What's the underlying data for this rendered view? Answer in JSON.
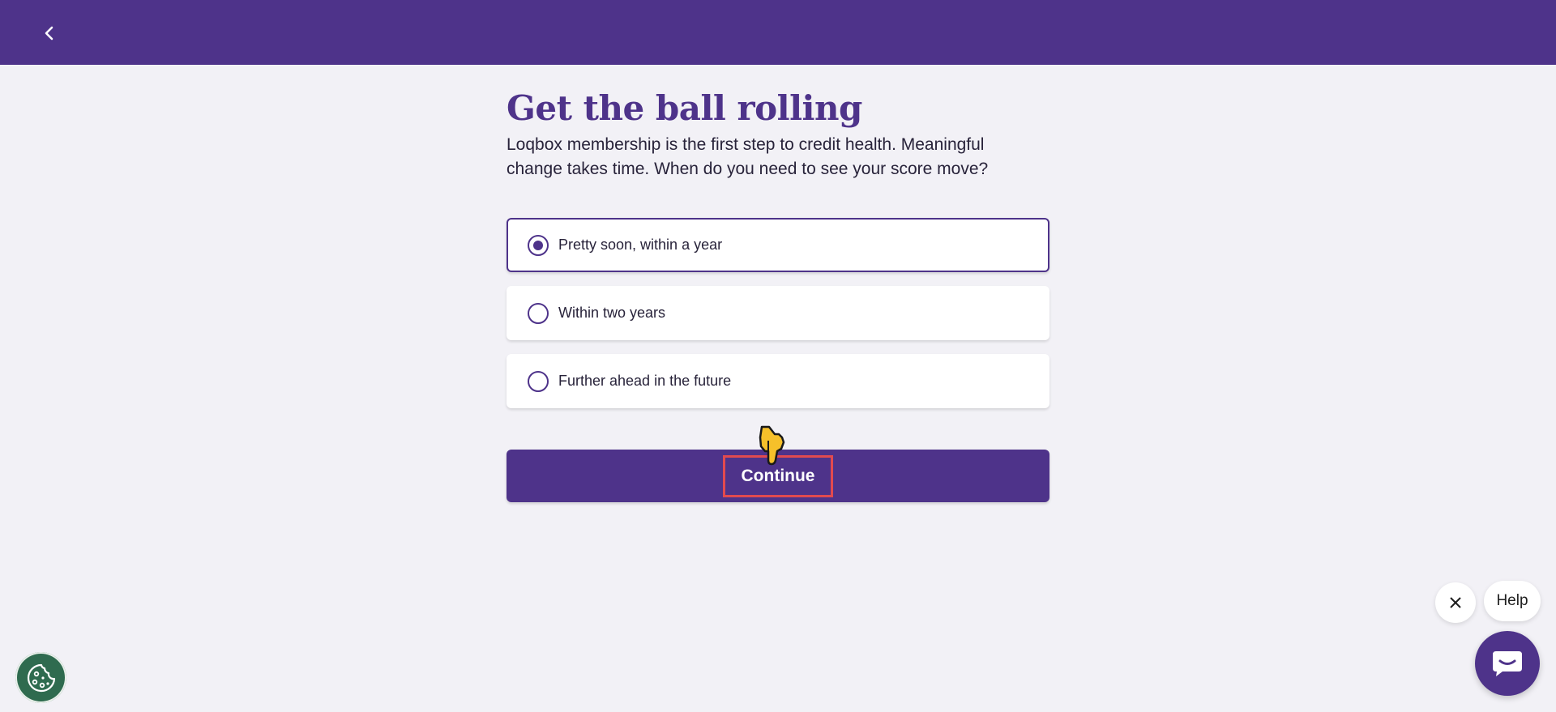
{
  "header": {
    "back_icon": "chevron-left-icon",
    "background_color": "#4e338a"
  },
  "main": {
    "title": "Get the ball rolling",
    "subtitle": "Loqbox membership is the first step to credit health. Meaningful change takes time. When do you need to see your score move?",
    "options": [
      {
        "label": "Pretty soon, within a year",
        "selected": true
      },
      {
        "label": "Within two years",
        "selected": false
      },
      {
        "label": "Further ahead in the future",
        "selected": false
      }
    ],
    "continue_label": "Continue",
    "accent_color": "#4e338a"
  },
  "widgets": {
    "cookie_icon": "cookie-icon",
    "help_label": "Help",
    "close_icon": "close-icon",
    "chat_icon": "chat-icon"
  }
}
